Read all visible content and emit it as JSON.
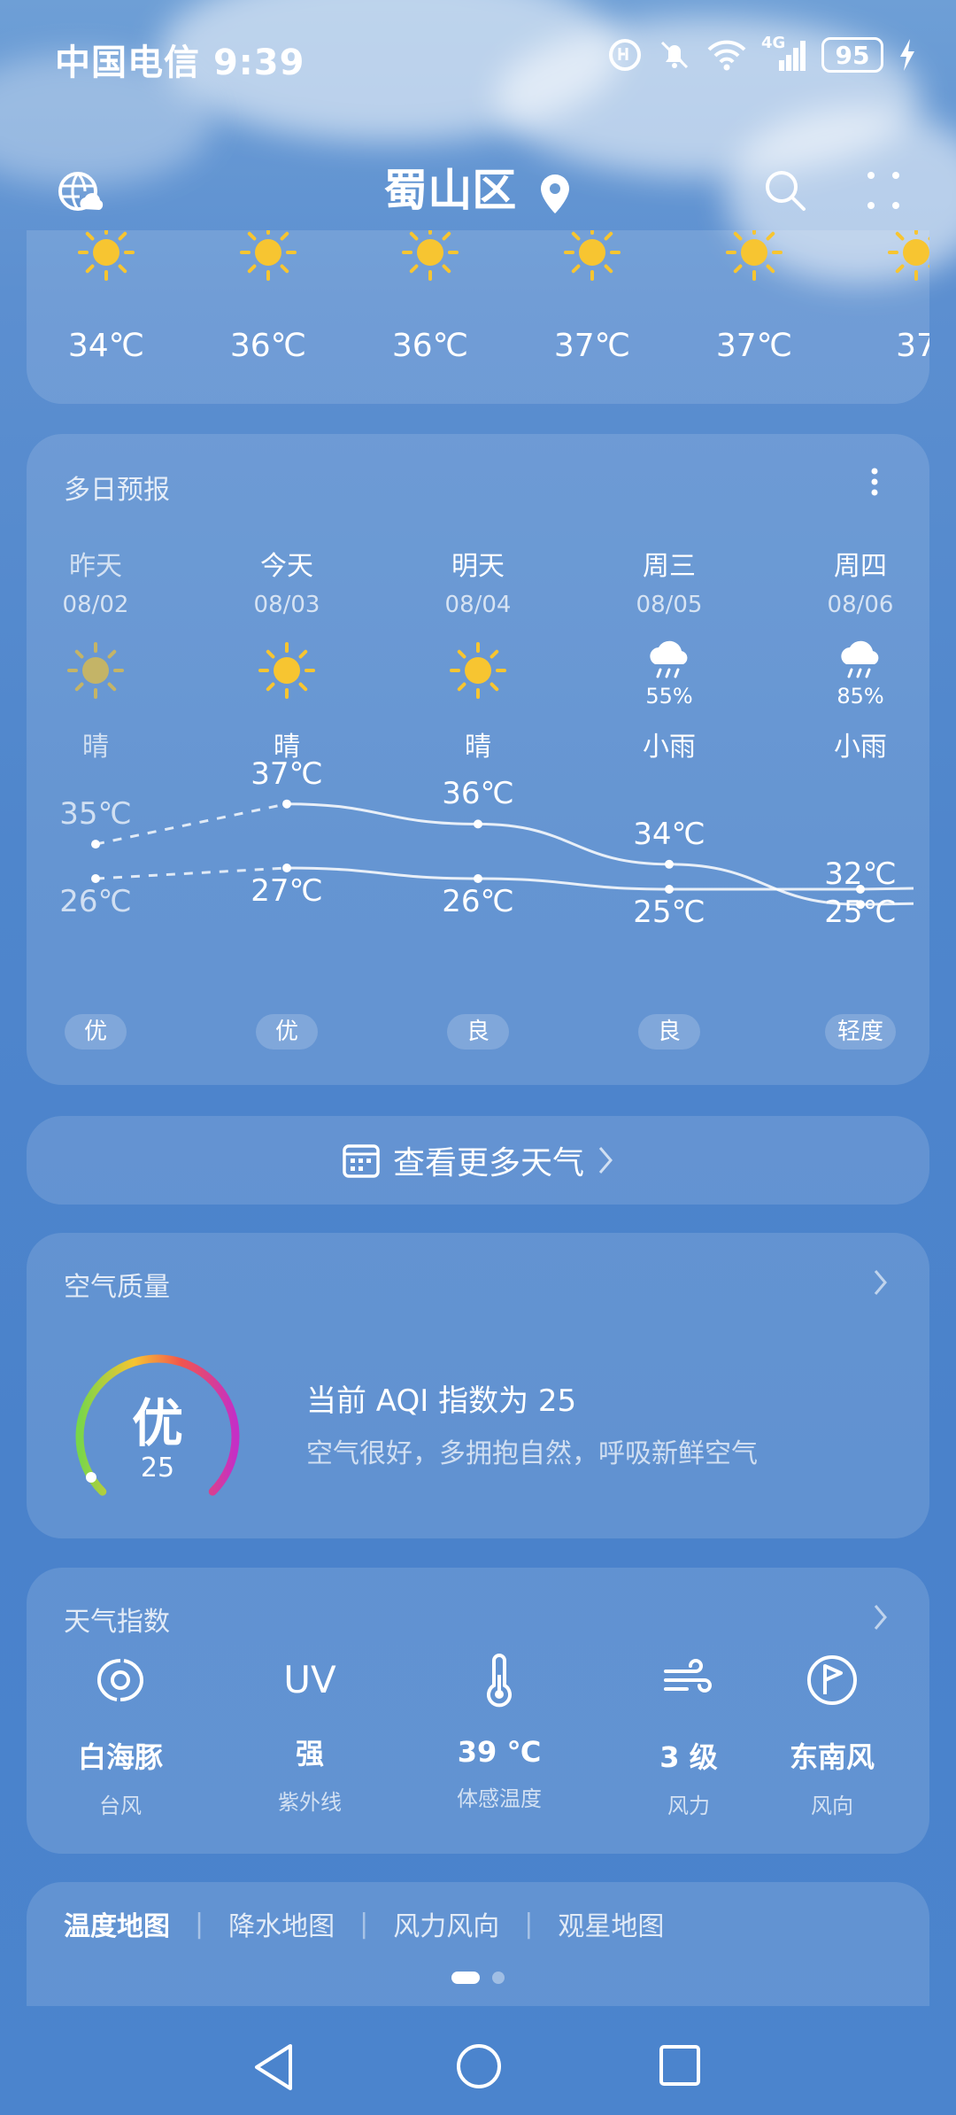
{
  "status_bar": {
    "carrier": "中国电信",
    "time": "9:39",
    "battery": "95",
    "network": "4G"
  },
  "header": {
    "location": "蜀山区"
  },
  "hourly": [
    {
      "temp": "34℃",
      "icon": "sun-icon"
    },
    {
      "temp": "36℃",
      "icon": "sun-icon"
    },
    {
      "temp": "36℃",
      "icon": "sun-icon"
    },
    {
      "temp": "37℃",
      "icon": "sun-icon"
    },
    {
      "temp": "37℃",
      "icon": "sun-icon"
    },
    {
      "temp": "37",
      "icon": "sun-icon"
    }
  ],
  "forecast": {
    "title": "多日预报",
    "days": [
      {
        "name": "昨天",
        "date": "08/02",
        "icon": "sun-icon",
        "precip": "",
        "cond": "晴",
        "high": "35℃",
        "low": "26℃",
        "aqi": "优",
        "high_value": 35,
        "low_value": 26
      },
      {
        "name": "今天",
        "date": "08/03",
        "icon": "sun-icon",
        "precip": "",
        "cond": "晴",
        "high": "37℃",
        "low": "27℃",
        "aqi": "优",
        "high_value": 37,
        "low_value": 27
      },
      {
        "name": "明天",
        "date": "08/04",
        "icon": "sun-icon",
        "precip": "",
        "cond": "晴",
        "high": "36℃",
        "low": "26℃",
        "aqi": "良",
        "high_value": 36,
        "low_value": 26
      },
      {
        "name": "周三",
        "date": "08/05",
        "icon": "rain-cloud-icon",
        "precip": "55%",
        "cond": "小雨",
        "high": "34℃",
        "low": "25℃",
        "aqi": "良",
        "high_value": 34,
        "low_value": 25
      },
      {
        "name": "周四",
        "date": "08/06",
        "icon": "rain-cloud-icon",
        "precip": "85%",
        "cond": "小雨",
        "high": "32℃",
        "low": "25℃",
        "aqi": "轻度",
        "high_value": 32,
        "low_value": 25
      }
    ]
  },
  "more_weather": {
    "label": "查看更多天气"
  },
  "air_quality": {
    "title": "空气质量",
    "level": "优",
    "value": "25",
    "aqi_fraction": 0.05,
    "headline": "当前 AQI 指数为 25",
    "desc": "空气很好，多拥抱自然，呼吸新鲜空气"
  },
  "indices": {
    "title": "天气指数",
    "items": [
      {
        "icon": "typhoon-icon",
        "value": "白海豚",
        "label": "台风"
      },
      {
        "icon": "uv-icon",
        "value": "强",
        "label": "紫外线",
        "glyph": "UV"
      },
      {
        "icon": "thermometer-icon",
        "value": "39 ℃",
        "label": "体感温度"
      },
      {
        "icon": "wind-icon",
        "value": "3 级",
        "label": "风力"
      },
      {
        "icon": "wind-direction-icon",
        "value": "东南风",
        "label": "风向"
      }
    ]
  },
  "maps": {
    "tabs": [
      "温度地图",
      "降水地图",
      "风力风向",
      "观星地图"
    ]
  },
  "colors": {
    "sun": "#f7c531",
    "sun_dim": "#c4b467",
    "gauge_start": "#79d64a",
    "gauge_mid": "#f6c431",
    "gauge_end": "#c42fc6"
  }
}
